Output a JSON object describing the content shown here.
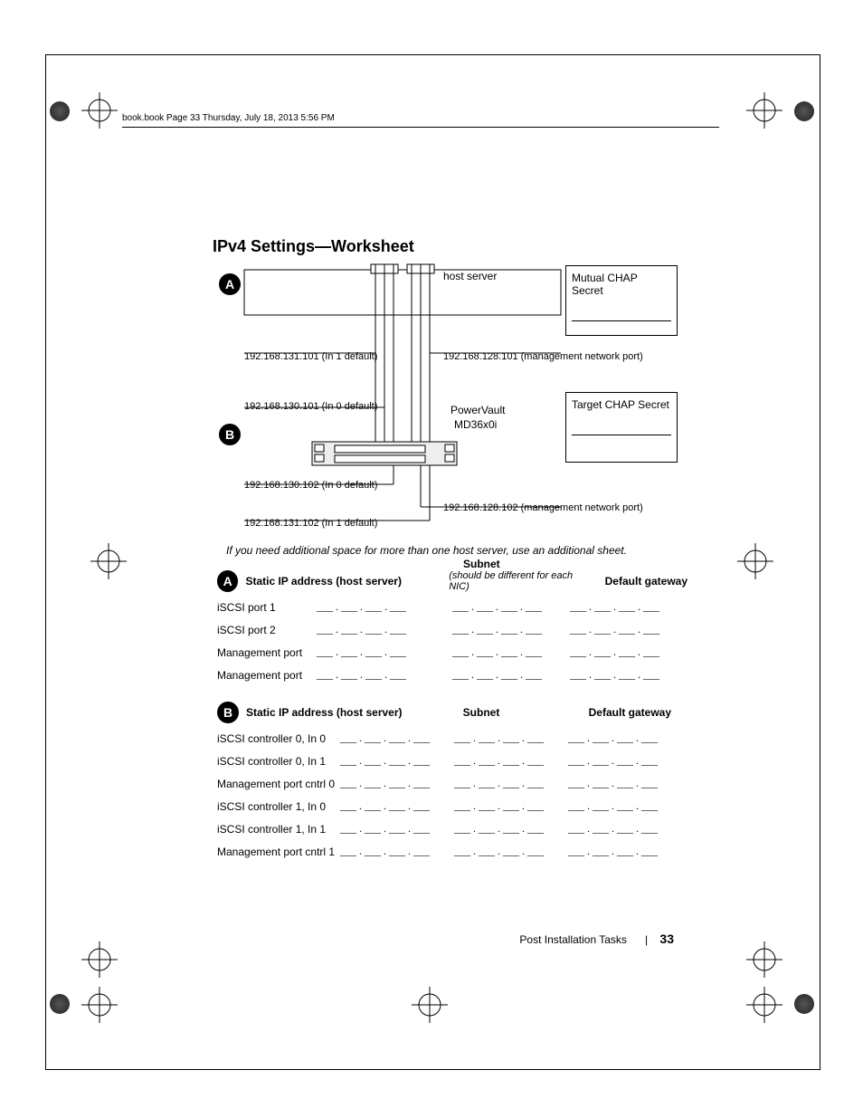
{
  "header": "book.book  Page 33  Thursday, July 18, 2013  5:56 PM",
  "title": "IPv4 Settings—Worksheet",
  "badges": {
    "a": "A",
    "b": "B"
  },
  "diagram": {
    "host_label": "host server",
    "mutual_chap": "Mutual CHAP Secret",
    "target_chap": "Target CHAP Secret",
    "ip_in1_a": "192.168.131.101 (In 1 default)",
    "ip_in0_a": "192.168.130.101 (In 0 default)",
    "ip_in0_b": "192.168.130.102 (In 0 default)",
    "ip_in1_b": "192.168.131.102 (In 1 default)",
    "mgmt_a": "192.168.128.101 (management network port)",
    "mgmt_b": "192.168.128.102 (management network port)",
    "device1": "PowerVault",
    "device2": "MD36x0i"
  },
  "note": "If you need additional space for more than one host server, use an additional sheet.",
  "sectionA": {
    "header_ip": "Static IP address (host server)",
    "header_subnet": "Subnet",
    "subnet_note": "(should be different for each NIC)",
    "header_gw": "Default gateway",
    "rows": [
      "iSCSI port 1",
      "iSCSI port 2",
      "Management port",
      "Management port"
    ]
  },
  "sectionB": {
    "header_ip": "Static IP address (host server)",
    "header_subnet": "Subnet",
    "header_gw": "Default gateway",
    "rows": [
      "iSCSI controller 0, In 0",
      "iSCSI controller 0, In 1",
      "Management port cntrl 0",
      "iSCSI controller 1, In 0",
      "iSCSI controller 1, In 1",
      "Management port cntrl 1"
    ]
  },
  "blank_ip": "___ . ___ . ___ . ___",
  "footer": {
    "section": "Post Installation Tasks",
    "sep": "|",
    "page": "33"
  }
}
